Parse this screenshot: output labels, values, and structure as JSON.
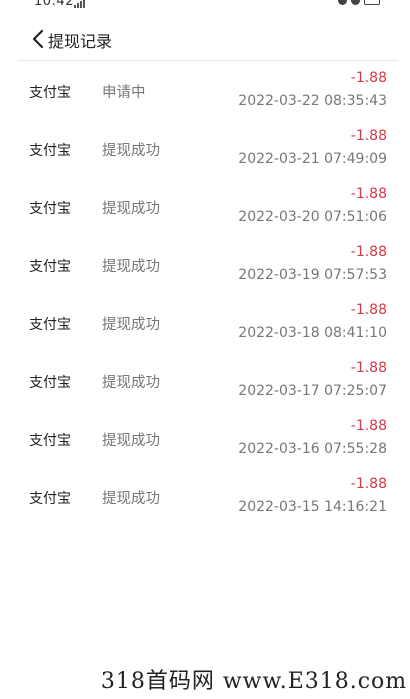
{
  "status_bar": {
    "time": "10:42"
  },
  "header": {
    "title": "提现记录"
  },
  "records": [
    {
      "method": "支付宝",
      "status": "申请中",
      "amount": "-1.88",
      "time": "2022-03-22 08:35:43"
    },
    {
      "method": "支付宝",
      "status": "提现成功",
      "amount": "-1.88",
      "time": "2022-03-21 07:49:09"
    },
    {
      "method": "支付宝",
      "status": "提现成功",
      "amount": "-1.88",
      "time": "2022-03-20 07:51:06"
    },
    {
      "method": "支付宝",
      "status": "提现成功",
      "amount": "-1.88",
      "time": "2022-03-19 07:57:53"
    },
    {
      "method": "支付宝",
      "status": "提现成功",
      "amount": "-1.88",
      "time": "2022-03-18 08:41:10"
    },
    {
      "method": "支付宝",
      "status": "提现成功",
      "amount": "-1.88",
      "time": "2022-03-17 07:25:07"
    },
    {
      "method": "支付宝",
      "status": "提现成功",
      "amount": "-1.88",
      "time": "2022-03-16 07:55:28"
    },
    {
      "method": "支付宝",
      "status": "提现成功",
      "amount": "-1.88",
      "time": "2022-03-15 14:16:21"
    }
  ],
  "watermark": "318首码网 www.E318.com",
  "colors": {
    "amount": "#d23a4a",
    "muted_text": "#777777",
    "divider": "#e6e6e6"
  },
  "icons": {
    "back": "chevron-left-icon",
    "signal": "signal-icon",
    "status_right": [
      "settings-icon",
      "alarm-icon",
      "battery-icon"
    ]
  }
}
